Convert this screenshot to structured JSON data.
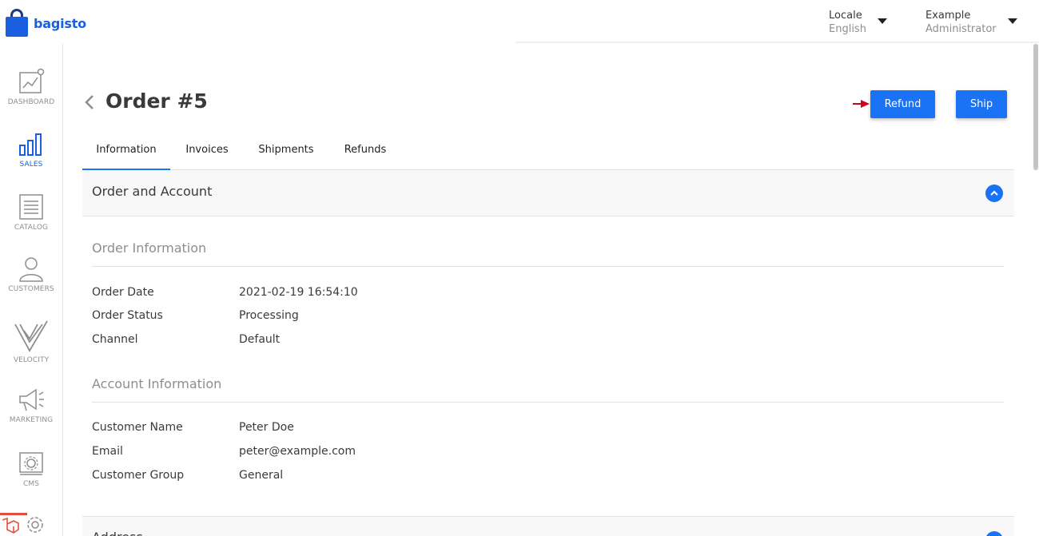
{
  "brand": {
    "name": "bagisto"
  },
  "header": {
    "locale": {
      "label": "Locale",
      "value": "English"
    },
    "user": {
      "name": "Example",
      "role": "Administrator"
    }
  },
  "sidebar": {
    "items": [
      {
        "label": "DASHBOARD",
        "icon": "chart-line-icon"
      },
      {
        "label": "SALES",
        "icon": "bar-chart-icon",
        "active": true
      },
      {
        "label": "CATALOG",
        "icon": "document-icon"
      },
      {
        "label": "CUSTOMERS",
        "icon": "user-icon"
      },
      {
        "label": "VELOCITY",
        "icon": "velocity-icon"
      },
      {
        "label": "MARKETING",
        "icon": "megaphone-icon"
      },
      {
        "label": "CMS",
        "icon": "cms-icon"
      },
      {
        "label": "",
        "icon": "gear-icon"
      }
    ]
  },
  "page": {
    "title": "Order #5",
    "actions": {
      "refund": "Refund",
      "ship": "Ship"
    }
  },
  "tabs": [
    {
      "label": "Information",
      "active": true
    },
    {
      "label": "Invoices"
    },
    {
      "label": "Shipments"
    },
    {
      "label": "Refunds"
    }
  ],
  "accordion": {
    "title": "Order and Account",
    "order_info": {
      "title": "Order Information",
      "rows": [
        {
          "label": "Order Date",
          "value": "2021-02-19 16:54:10"
        },
        {
          "label": "Order Status",
          "value": "Processing"
        },
        {
          "label": "Channel",
          "value": "Default"
        }
      ]
    },
    "account_info": {
      "title": "Account Information",
      "rows": [
        {
          "label": "Customer Name",
          "value": "Peter Doe"
        },
        {
          "label": "Email",
          "value": "peter@example.com"
        },
        {
          "label": "Customer Group",
          "value": "General"
        }
      ]
    }
  },
  "accordion2": {
    "title": "Address"
  },
  "colors": {
    "accent": "#1a73f5",
    "brand": "#1a5fe0",
    "annotation": "#d0021b"
  }
}
